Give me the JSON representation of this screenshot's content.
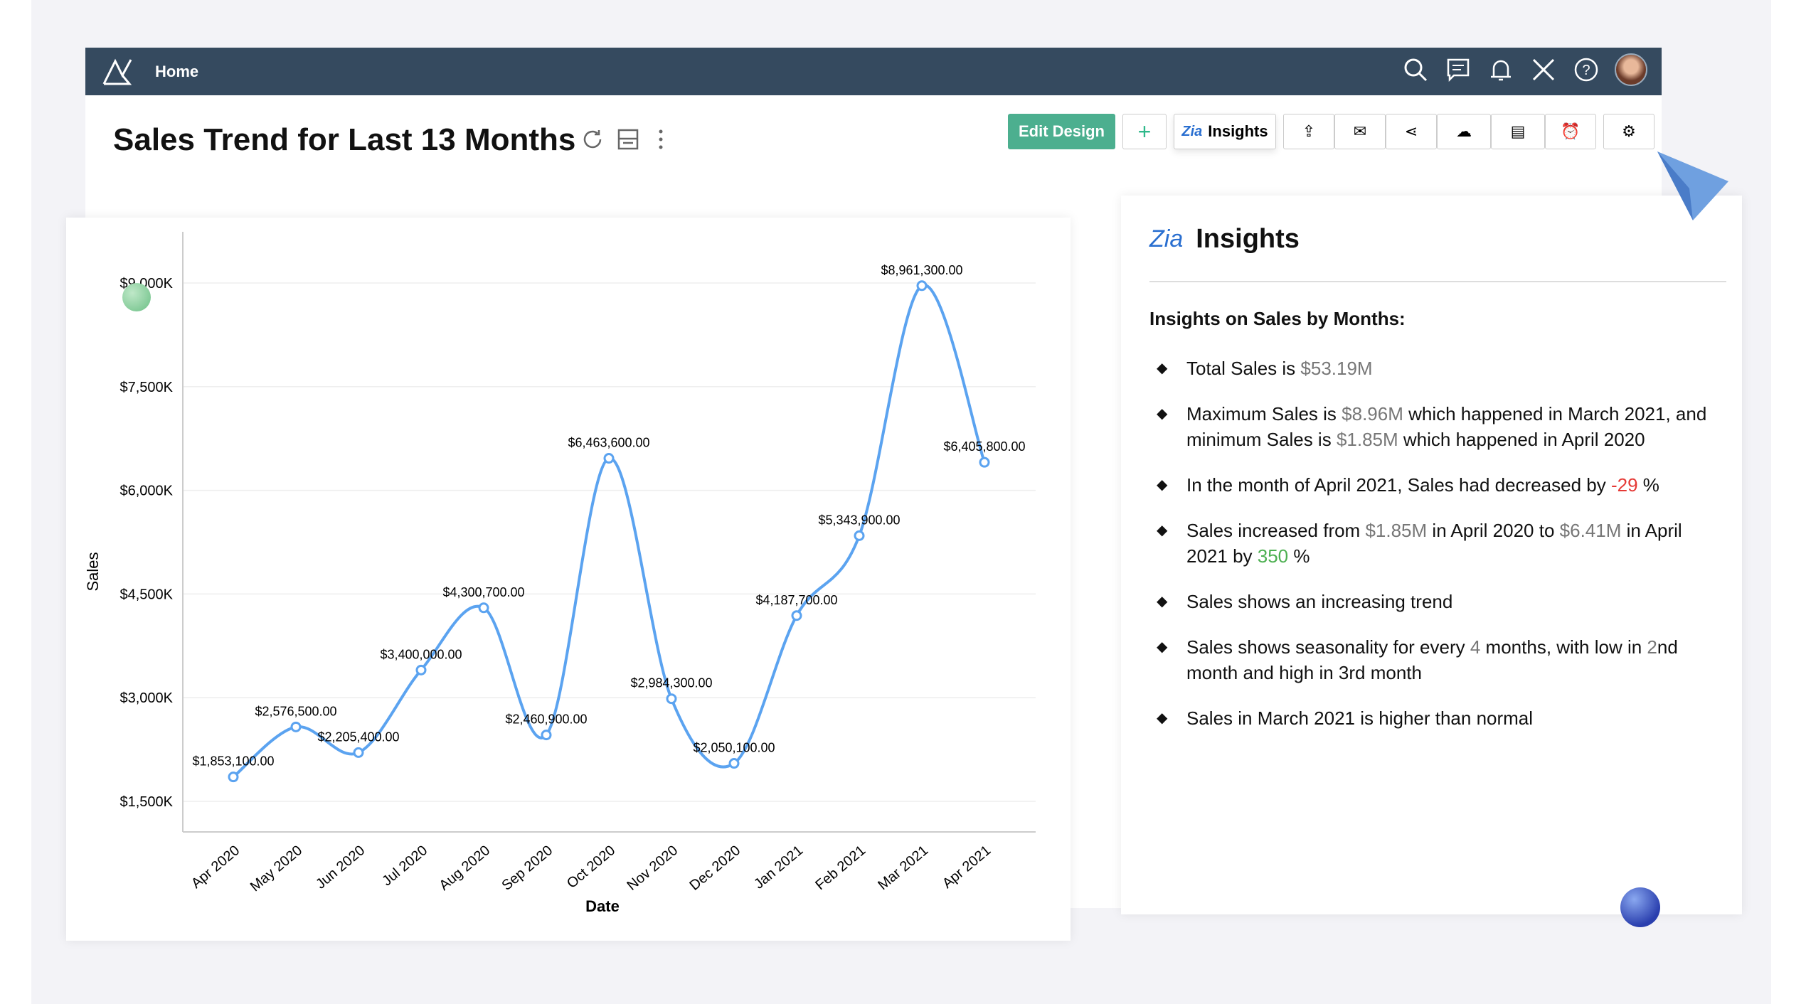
{
  "topbar": {
    "home": "Home"
  },
  "title": "Sales Trend for Last 13 Months",
  "toolbar": {
    "edit_design": "Edit Design",
    "add": "+",
    "insights": "Insights"
  },
  "chart_data": {
    "type": "line",
    "xlabel": "Date",
    "ylabel": "Sales",
    "categories": [
      "Apr 2020",
      "May 2020",
      "Jun 2020",
      "Jul 2020",
      "Aug 2020",
      "Sep 2020",
      "Oct 2020",
      "Nov 2020",
      "Dec 2020",
      "Jan 2021",
      "Feb 2021",
      "Mar 2021",
      "Apr 2021"
    ],
    "values": [
      1853100,
      2576500,
      2205400,
      3400000,
      4300700,
      2460900,
      6463600,
      2984300,
      2050100,
      4187700,
      5343900,
      8961300,
      6405800
    ],
    "data_labels": [
      "$1,853,100.00",
      "$2,576,500.00",
      "$2,205,400.00",
      "$3,400,000.00",
      "$4,300,700.00",
      "$2,460,900.00",
      "$6,463,600.00",
      "$2,984,300.00",
      "$2,050,100.00",
      "$4,187,700.00",
      "$5,343,900.00",
      "$8,961,300.00",
      "$6,405,800.00"
    ],
    "yticks": [
      1500000,
      3000000,
      4500000,
      6000000,
      7500000,
      9000000
    ],
    "ytick_labels": [
      "$1,500K",
      "$3,000K",
      "$4,500K",
      "$6,000K",
      "$7,500K",
      "$9,000K"
    ],
    "grid": true,
    "color": "#5ba3f0"
  },
  "insights": {
    "title": "Insights",
    "subtitle": "Insights on Sales by Months:",
    "items": [
      [
        [
          "t",
          "Total Sales is "
        ],
        [
          "g",
          "$53.19M"
        ]
      ],
      [
        [
          "t",
          "Maximum Sales is "
        ],
        [
          "g",
          "$8.96M"
        ],
        [
          "t",
          " which happened in March 2021, and minimum Sales is "
        ],
        [
          "g",
          "$1.85M"
        ],
        [
          "t",
          " which happened  in April 2020"
        ]
      ],
      [
        [
          "t",
          "In the month of April 2021, Sales had decreased by "
        ],
        [
          "r",
          "-29"
        ],
        [
          "t",
          " %"
        ]
      ],
      [
        [
          "t",
          "Sales increased from  "
        ],
        [
          "g",
          "$1.85M"
        ],
        [
          "t",
          " in April 2020 to "
        ],
        [
          "g",
          "$6.41M"
        ],
        [
          "t",
          " in April 2021 by "
        ],
        [
          "gr",
          "350"
        ],
        [
          "t",
          " %"
        ]
      ],
      [
        [
          "t",
          "Sales shows an increasing trend"
        ]
      ],
      [
        [
          "t",
          "Sales shows seasonality for every "
        ],
        [
          "g",
          "4"
        ],
        [
          "t",
          " months, with low in "
        ],
        [
          "g",
          "2"
        ],
        [
          "t",
          "nd month and high in 3rd month"
        ]
      ],
      [
        [
          "t",
          "Sales in March 2021 is higher than normal"
        ]
      ]
    ]
  }
}
